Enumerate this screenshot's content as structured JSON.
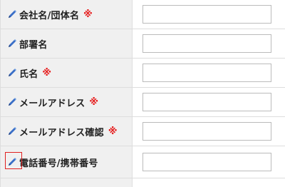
{
  "form": {
    "rows": [
      {
        "label": "会社名/団体名",
        "required_mark": "※",
        "value": "",
        "icon": "pencil-icon"
      },
      {
        "label": "部署名",
        "required_mark": "",
        "value": "",
        "icon": "pencil-icon"
      },
      {
        "label": "氏名",
        "required_mark": "※",
        "value": "",
        "icon": "pencil-icon"
      },
      {
        "label": "メールアドレス",
        "required_mark": "※",
        "value": "",
        "icon": "pencil-icon"
      },
      {
        "label": "メールアドレス確認",
        "required_mark": "※",
        "value": "",
        "icon": "pencil-icon"
      },
      {
        "label": "電話番号/携帯番号",
        "required_mark": "",
        "value": "",
        "icon": "pencil-icon",
        "highlighted": true
      }
    ]
  },
  "colors": {
    "label_bg": "#f0f0f0",
    "required": "#e61e1e",
    "pencil": "#3a6fc7",
    "highlight": "#e02020"
  }
}
